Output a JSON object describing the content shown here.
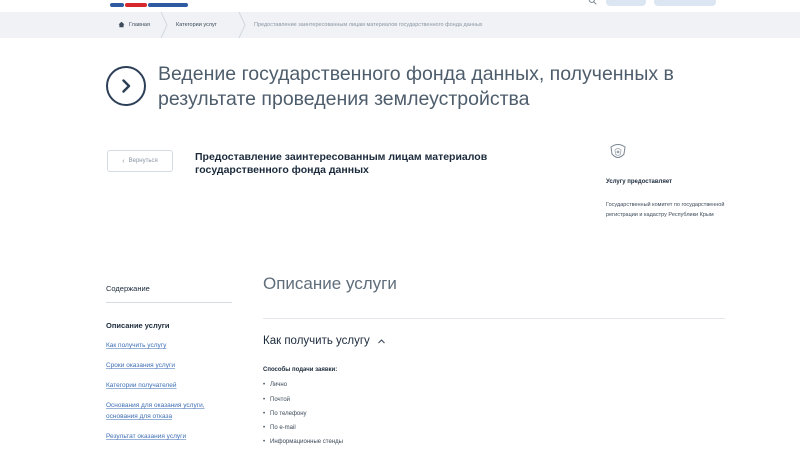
{
  "colors": {
    "breadcrumb_bg": "#f0f2f5",
    "title_icon": "#2c3f57",
    "link": "#3f6fb5",
    "text_dark": "#1b2a3b",
    "text_muted": "#4e5d6c"
  },
  "breadcrumb": {
    "items": [
      {
        "label": "Главная",
        "icon": "home-icon"
      },
      {
        "label": "Категории услуг"
      },
      {
        "label": "Предоставление заинтересованным лицам материалов государственного фонда данных"
      }
    ]
  },
  "page_title": "Ведение государственного фонда данных, полученных в результате проведения землеустройства",
  "back_button": {
    "label": "Вернуться",
    "icon": "chevron-left-icon"
  },
  "service_title": "Предоставление заинтересованным лицам материалов государственного фонда данных",
  "provider": {
    "emblem_icon": "coat-of-arms-icon",
    "label": "Услугу предоставляет",
    "name": "Государственный комитет по государственной регистрации и кадастру Республики Крым"
  },
  "toc": {
    "heading": "Содержание",
    "active": "Описание услуги",
    "links": [
      "Как получить услугу",
      "Сроки оказания услуги",
      "Категории получателей",
      "Основания для оказания услуги,",
      "основания для отказа",
      "Результат оказания услуги"
    ]
  },
  "main": {
    "section_title": "Описание услуги",
    "how_to_get": {
      "label": "Как получить услугу",
      "icon": "chevron-up-icon"
    },
    "methods_label": "Способы подачи заявки:",
    "methods": [
      "Лично",
      "Почтой",
      "По телефону",
      "По e-mail",
      "Информационные стенды"
    ]
  }
}
